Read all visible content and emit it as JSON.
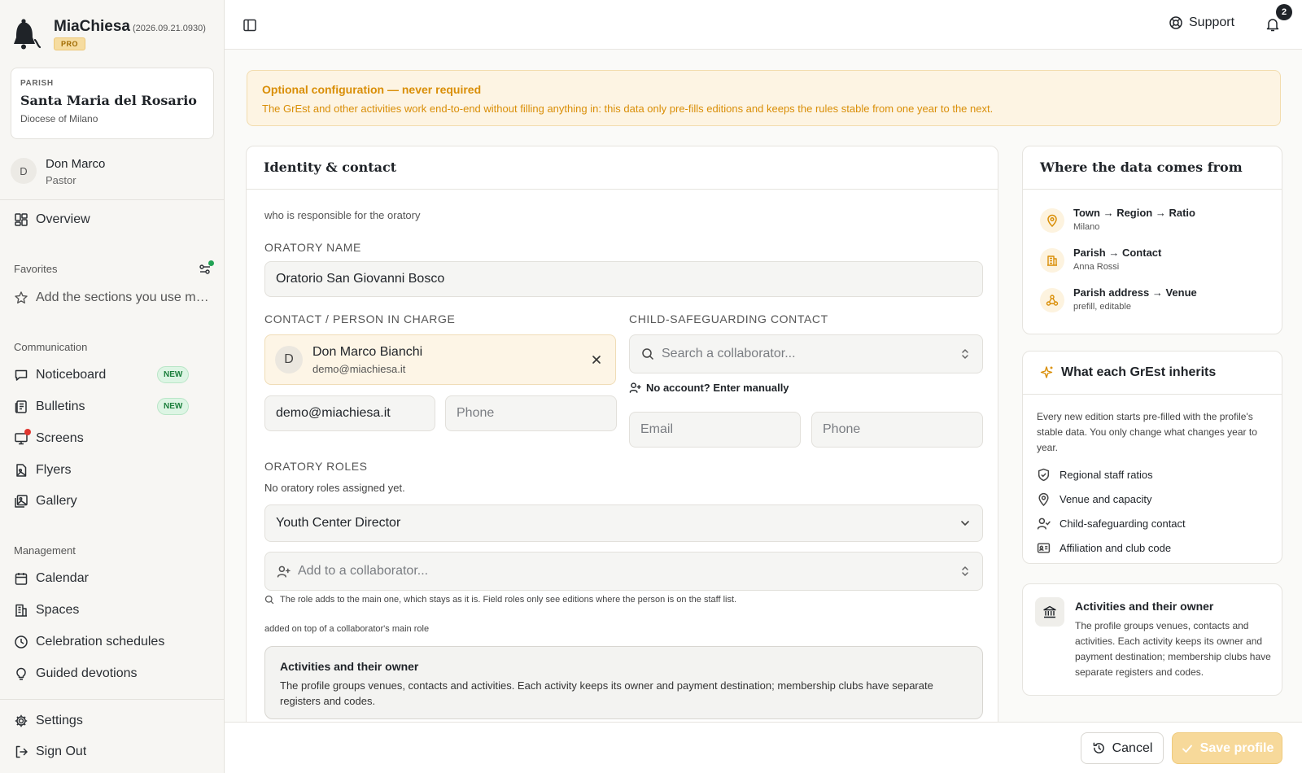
{
  "app": {
    "name": "MiaChiesa",
    "version": "(2026.09.21.0930)",
    "badge": "PRO"
  },
  "parish": {
    "kicker": "PARISH",
    "name": "Santa Maria del Rosario",
    "diocese": "Diocese of Milano"
  },
  "user": {
    "initial": "D",
    "name": "Don Marco",
    "role": "Pastor"
  },
  "nav": {
    "overview": "Overview",
    "favorites_label": "Favorites",
    "favorites_hint": "Add the sections you use most",
    "communication_label": "Communication",
    "noticeboard": "Noticeboard",
    "bulletins": "Bulletins",
    "screens": "Screens",
    "flyers": "Flyers",
    "gallery": "Gallery",
    "new_badge": "NEW",
    "management_label": "Management",
    "calendar": "Calendar",
    "spaces": "Spaces",
    "celebration_schedules": "Celebration schedules",
    "guided_devotions": "Guided devotions",
    "settings": "Settings",
    "sign_out": "Sign Out"
  },
  "topbar": {
    "support": "Support",
    "notifications": "2"
  },
  "banner": {
    "title": "Optional configuration — never required",
    "text": "The GrEst and other activities work end-to-end without filling anything in: this data only pre-fills editions and keeps the rules stable from one year to the next."
  },
  "identity": {
    "title": "Identity & contact",
    "subtitle": "who is responsible for the oratory",
    "oratory_name_label": "ORATORY NAME",
    "oratory_name_value": "Oratorio San Giovanni Bosco",
    "contact_label": "CONTACT / PERSON IN CHARGE",
    "contact_initial": "D",
    "contact_name": "Don Marco Bianchi",
    "contact_email": "demo@miachiesa.it",
    "contact_email_field": "demo@miachiesa.it",
    "phone_placeholder": "Phone",
    "safeguarding_label": "CHILD-SAFEGUARDING CONTACT",
    "safeguarding_search_placeholder": "Search a collaborator...",
    "no_account_link": "No account? Enter manually",
    "email_placeholder": "Email",
    "roles_label": "ORATORY ROLES",
    "roles_empty": "No oratory roles assigned yet.",
    "role_selected": "Youth Center Director",
    "add_collaborator_placeholder": "Add to a collaborator...",
    "roles_hint": "The role adds to the main one, which stays as it is. Field roles only see editions where the person is on the staff list.",
    "roles_hint2": "added on top of a collaborator's main role",
    "info_title": "Activities and their owner",
    "info_text": "The profile groups venues, contacts and activities. Each activity keeps its owner and payment destination; membership clubs have separate registers and codes."
  },
  "sources": {
    "title": "Where the data comes from",
    "items": [
      {
        "title": "Town → Region → Ratio",
        "sub": "Milano",
        "icon": "map-pin-icon"
      },
      {
        "title": "Parish → Contact",
        "sub": "Anna Rossi",
        "icon": "building-icon"
      },
      {
        "title": "Parish address → Venue",
        "sub": "prefill, editable",
        "icon": "network-icon"
      }
    ]
  },
  "inherits": {
    "title": "What each GrEst inherits",
    "intro": "Every new edition starts pre-filled with the profile's stable data. You only change what changes year to year.",
    "items": [
      {
        "label": "Regional staff ratios",
        "icon": "shield-check-icon"
      },
      {
        "label": "Venue and capacity",
        "icon": "map-pin-icon"
      },
      {
        "label": "Child-safeguarding contact",
        "icon": "user-check-icon"
      },
      {
        "label": "Affiliation and club code",
        "icon": "id-card-icon"
      }
    ]
  },
  "owner_card": {
    "title": "Activities and their owner",
    "text": "The profile groups venues, contacts and activities. Each activity keeps its owner and payment destination; membership clubs have separate registers and codes."
  },
  "actions": {
    "cancel": "Cancel",
    "save": "Save profile"
  },
  "colors": {
    "accent_orange": "#d98e07",
    "banner_bg": "#fdf4e3",
    "new_badge_green": "#1b7f3c",
    "notification_dot_red": "#e0362f",
    "save_button_bg": "#f7d99a"
  }
}
